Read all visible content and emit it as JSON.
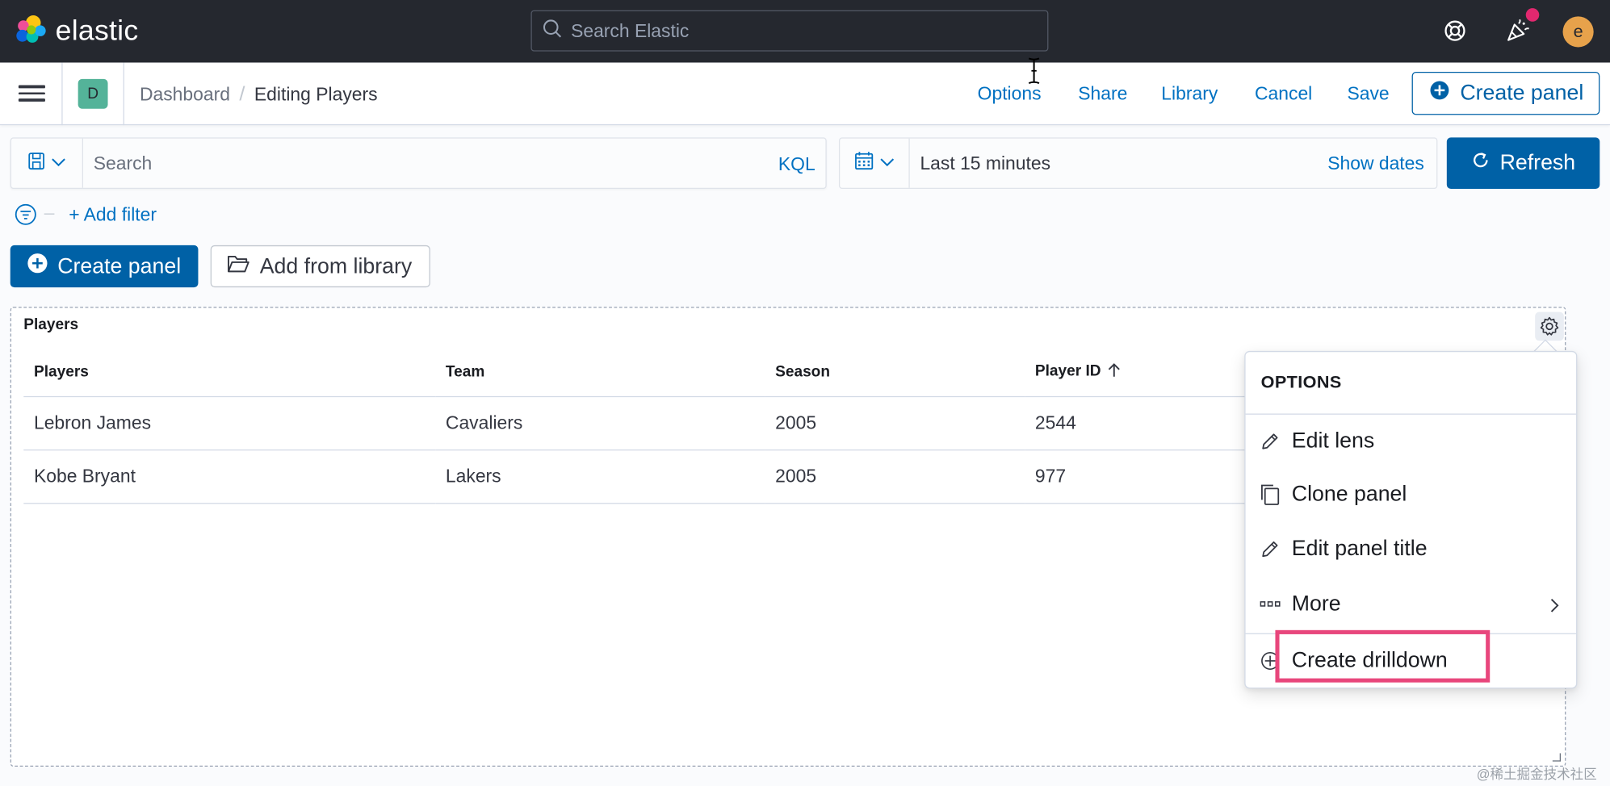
{
  "header": {
    "brand": "elastic",
    "search_placeholder": "Search Elastic",
    "user_initial": "e"
  },
  "subheader": {
    "space_initial": "D",
    "breadcrumb_parent": "Dashboard",
    "breadcrumb_current": "Editing Players",
    "links": {
      "options": "Options",
      "share": "Share",
      "library": "Library",
      "cancel": "Cancel",
      "save": "Save"
    },
    "create_panel": "Create panel"
  },
  "query": {
    "search_placeholder": "Search",
    "language": "KQL",
    "time_range": "Last 15 minutes",
    "show_dates": "Show dates",
    "refresh": "Refresh",
    "add_filter": "+ Add filter"
  },
  "actions": {
    "create_panel": "Create panel",
    "add_from_library": "Add from library"
  },
  "panel": {
    "title": "Players",
    "columns": [
      "Players",
      "Team",
      "Season",
      "Player ID"
    ],
    "rows": [
      [
        "Lebron James",
        "Cavaliers",
        "2005",
        "2544"
      ],
      [
        "Kobe Bryant",
        "Lakers",
        "2005",
        "977"
      ]
    ]
  },
  "options_menu": {
    "title": "OPTIONS",
    "items": {
      "edit_lens": "Edit lens",
      "clone_panel": "Clone panel",
      "edit_panel_title": "Edit panel title",
      "more": "More",
      "create_drilldown": "Create drilldown"
    }
  },
  "watermark": "@稀土掘金技术社区",
  "colors": {
    "header_bg": "#25282f",
    "primary": "#0061a6",
    "link": "#0071c2",
    "highlight": "#e8467c",
    "space_avatar": "#54b399",
    "user_avatar": "#e7a24b"
  }
}
